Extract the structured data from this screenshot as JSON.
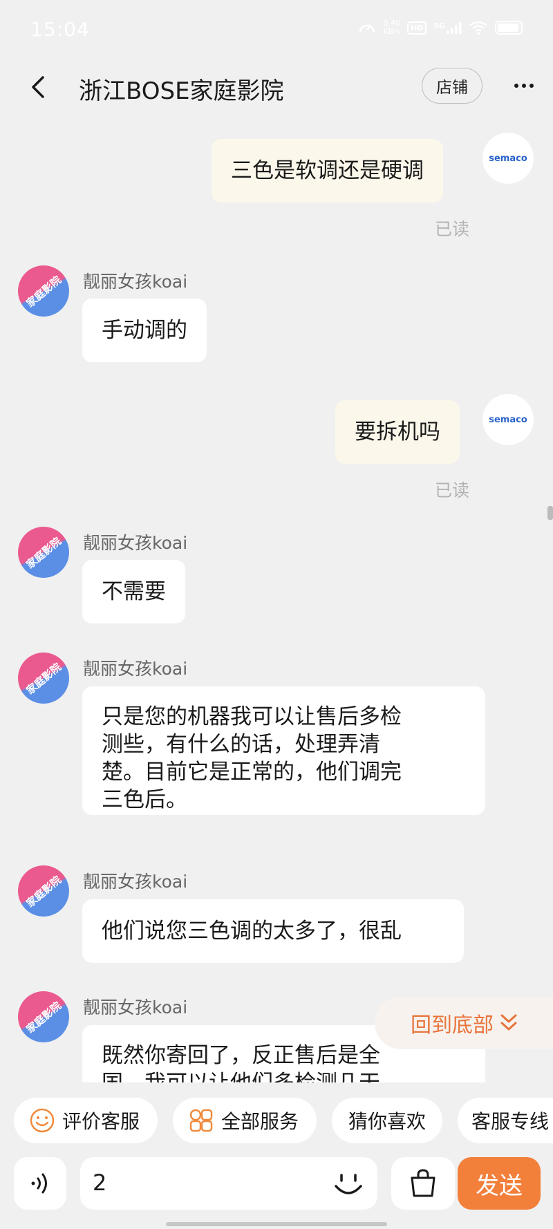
{
  "status_bar": {
    "time": "15:04",
    "net_speed_value": "0.40",
    "net_speed_unit": "KB/s",
    "hd_label": "HD",
    "signal_label": "5G"
  },
  "header": {
    "title": "浙江BOSE家庭影院",
    "shop_button": "店铺"
  },
  "chat": {
    "read_label": "已读",
    "agent_name": "靓丽女孩koai",
    "agent_avatar_text": "家庭影院",
    "user_avatar_text": "semaco",
    "messages": [
      {
        "text": "三色是软调还是硬调"
      },
      {
        "text": "手动调的"
      },
      {
        "text": "要拆机吗"
      },
      {
        "text": "不需要"
      },
      {
        "lines": [
          "只是您的机器我可以让售后多检",
          "测些，有什么的话，处理弄清",
          "楚。目前它是正常的，他们调完",
          "三色后。"
        ]
      },
      {
        "text": "他们说您三色调的太多了，很乱"
      },
      {
        "lines": [
          "既然你寄回了，反正售后是全",
          "国，我可以让他们多检测几天"
        ]
      }
    ],
    "back_to_bottom": "回到底部"
  },
  "quick_actions": [
    {
      "label": "评价客服",
      "icon": "smile-icon"
    },
    {
      "label": "全部服务",
      "icon": "grid-icon"
    },
    {
      "label": "猜你喜欢"
    },
    {
      "label": "客服专线"
    }
  ],
  "input": {
    "value": "2",
    "send_label": "发送"
  },
  "colors": {
    "accent": "#f27f3a",
    "my_bubble": "#fbf7ea",
    "their_bubble": "#ffffff",
    "background": "#f0f0f0"
  }
}
